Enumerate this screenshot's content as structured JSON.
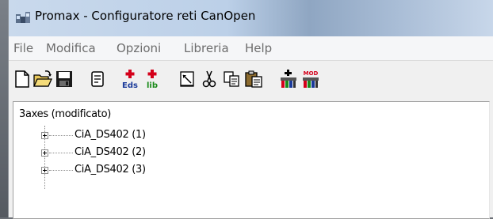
{
  "window": {
    "title": "Promax - Configuratore reti CanOpen"
  },
  "menu": [
    {
      "label": "File"
    },
    {
      "label": "Modifica"
    },
    {
      "label": "Opzioni"
    },
    {
      "label": "Libreria"
    },
    {
      "label": "Help"
    }
  ],
  "toolbar": {
    "buttons": [
      {
        "icon": "new-document-icon"
      },
      {
        "icon": "open-folder-icon"
      },
      {
        "icon": "save-icon"
      },
      {
        "icon": "properties-icon"
      },
      {
        "icon": "add-eds-icon",
        "text": "Eds"
      },
      {
        "icon": "add-lib-icon",
        "text": "lib"
      },
      {
        "icon": "edit-icon"
      },
      {
        "icon": "cut-icon"
      },
      {
        "icon": "copy-icon"
      },
      {
        "icon": "paste-icon"
      },
      {
        "icon": "network-icon"
      },
      {
        "icon": "network-mod-icon",
        "text": "MOD"
      }
    ]
  },
  "tree": {
    "root": "3axes (modificato)",
    "children": [
      {
        "label": "CiA_DS402 (1)"
      },
      {
        "label": "CiA_DS402 (2)"
      },
      {
        "label": "CiA_DS402 (3)"
      }
    ]
  },
  "colors": {
    "title_gradient": "#bcd0e8",
    "menu_text": "#6d6d6d",
    "eds_red": "#d4001a",
    "lib_green": "#1a8a1a"
  }
}
